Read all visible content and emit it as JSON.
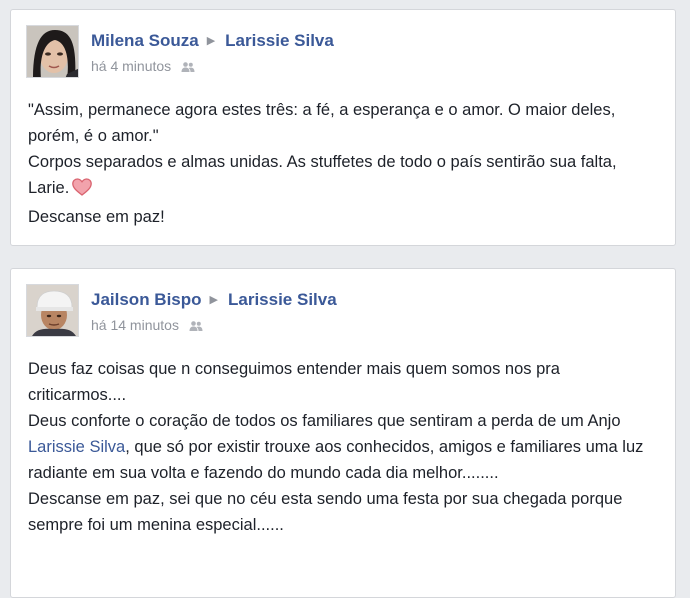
{
  "posts": [
    {
      "author": "Milena Souza",
      "target": "Larissie Silva",
      "time": "há 4 minutos",
      "audience_icon": "friends-icon",
      "lines": [
        "\"Assim, permanece agora estes três: a fé, a esperança e o amor. O maior deles, porém, é o amor.\"",
        "Corpos separados e almas unidas. As stuffetes de todo o país sentirão sua falta, Larie.",
        "Descanse em paz!"
      ],
      "emoji_icon": "heart-icon"
    },
    {
      "author": "Jailson Bispo",
      "target": "Larissie Silva",
      "time": "há 14 minutos",
      "audience_icon": "friends-icon",
      "line1": "Deus faz coisas que n conseguimos entender mais quem somos nos pra criticarmos....",
      "line2_before": "Deus conforte o coração de todos os familiares que sentiram a perda de um Anjo ",
      "mention": "Larissie Silva",
      "line2_after": ", que só por existir trouxe aos conhecidos, amigos e familiares uma luz radiante em sua volta e fazendo do mundo cada dia melhor........",
      "line3": "Descanse em paz, sei que no céu esta sendo uma festa por sua chegada porque sempre foi um menina especial......"
    }
  ],
  "colors": {
    "link": "#3b5998",
    "meta": "#90949c",
    "text": "#1d2129",
    "background": "#e9ebee",
    "heart": "#e87a86"
  }
}
